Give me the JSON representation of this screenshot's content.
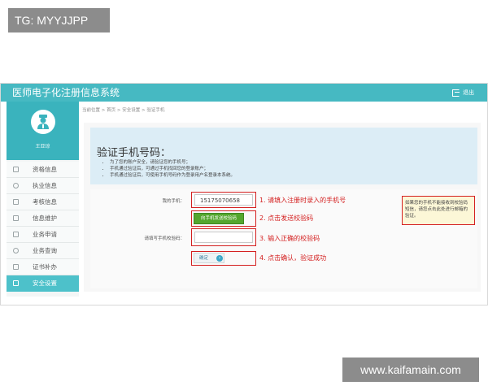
{
  "watermarks": {
    "top_left": "TG: MYYJJPP",
    "bottom_right": "www.kaifamain.com"
  },
  "header": {
    "app_title": "医师电子化注册信息系统",
    "exit_label": "退出"
  },
  "sidebar": {
    "username": "王亚琼",
    "items": [
      {
        "label": "资格信息",
        "icon": "document-icon"
      },
      {
        "label": "执业信息",
        "icon": "headset-icon"
      },
      {
        "label": "考核信息",
        "icon": "clipboard-icon"
      },
      {
        "label": "信息维护",
        "icon": "edit-icon"
      },
      {
        "label": "业务申请",
        "icon": "form-icon"
      },
      {
        "label": "业务查询",
        "icon": "search-icon"
      },
      {
        "label": "证书补办",
        "icon": "certificate-icon"
      },
      {
        "label": "安全设置",
        "icon": "lock-icon",
        "active": true
      }
    ]
  },
  "breadcrumb": "当前位置 > 首页 > 安全设置 > 验证手机",
  "info": {
    "title": "验证手机号码：",
    "bullets": [
      "为了您的账户安全，请验证您的手机号；",
      "手机通过验证后，可通过手机找回您的登录账户；",
      "手机通过验证后，可使用手机号码作为登录用户名登录本系统。"
    ]
  },
  "form": {
    "phone_label": "我的手机：",
    "phone_value": "15175070658",
    "send_code_label": "向手机发送校验码",
    "code_label": "请填写手机校验码：",
    "code_value": "",
    "confirm_label": "确定"
  },
  "annotations": {
    "step1": "1. 请填入注册时录入的手机号",
    "step2": "2. 点击发送校验码",
    "step3": "3. 输入正确的校验码",
    "step4": "4. 点击确认，验证成功",
    "tip": "如果您的手机不能接收到校验码短信，请您点击此处进行邮箱的验证。"
  },
  "colors": {
    "titlebar": "#46b9c2",
    "active_menu": "#4dc1ca",
    "annotation": "#d42020",
    "send_button": "#54a62e"
  }
}
